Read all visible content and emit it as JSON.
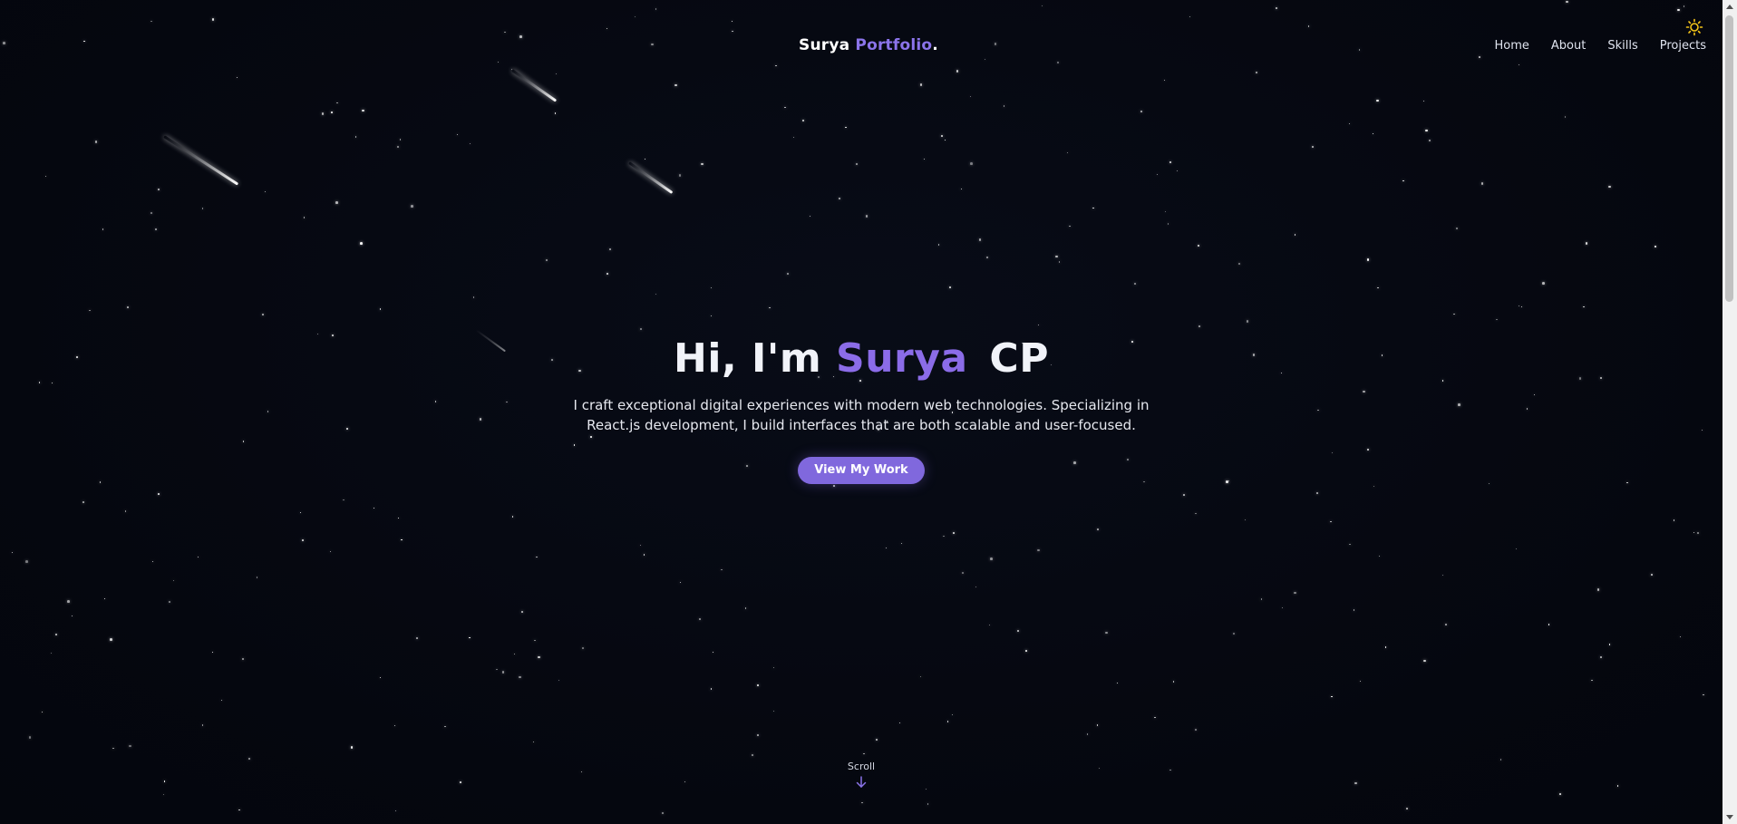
{
  "nav": {
    "logo_first": "Surya",
    "logo_second": "Portfolio",
    "logo_dot": ".",
    "links": [
      "Home",
      "About",
      "Skills",
      "Projects"
    ],
    "theme_icon": "sun-icon"
  },
  "hero": {
    "greeting": "Hi, I'm",
    "name_first": "Surya",
    "name_last": "CP",
    "description": "I craft exceptional digital experiences with modern web technologies. Specializing in React.js development, I build interfaces that are both scalable and user-focused.",
    "cta_label": "View My Work"
  },
  "scroll": {
    "label": "Scroll",
    "icon": "arrow-down-icon"
  },
  "colors": {
    "background": "#060912",
    "accent": "#8068dd",
    "sun": "#f5c518"
  }
}
